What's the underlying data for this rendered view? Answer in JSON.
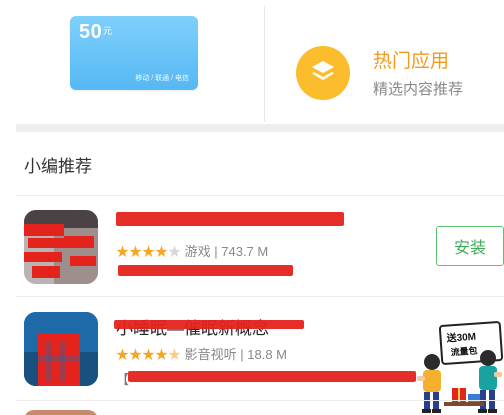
{
  "promo": {
    "amount": "50",
    "unit": "元",
    "carriers": "移动 / 联通 / 电信"
  },
  "hot_apps": {
    "title": "热门应用",
    "subtitle": "精选内容推荐"
  },
  "section": {
    "title": "小编推荐"
  },
  "apps": [
    {
      "stars_filled": "★★★★",
      "stars_empty": "★",
      "rating": 4,
      "meta": "游戏 | 743.7 M",
      "install_label": "安装"
    },
    {
      "name": "小睡眠—催眠新概念",
      "stars_filled": "★★★★",
      "stars_half": "★",
      "rating": 4.5,
      "meta": "影音视听 | 18.8 M",
      "desc_prefix": "【",
      "sticker_line1": "送30M",
      "sticker_line2": "流量包"
    }
  ],
  "colors": {
    "accent_orange": "#f59a1b",
    "install_green": "#3bb058",
    "star": "#f5a623",
    "promo_blue": "#55b8f4",
    "redaction_red": "#e5231d"
  }
}
